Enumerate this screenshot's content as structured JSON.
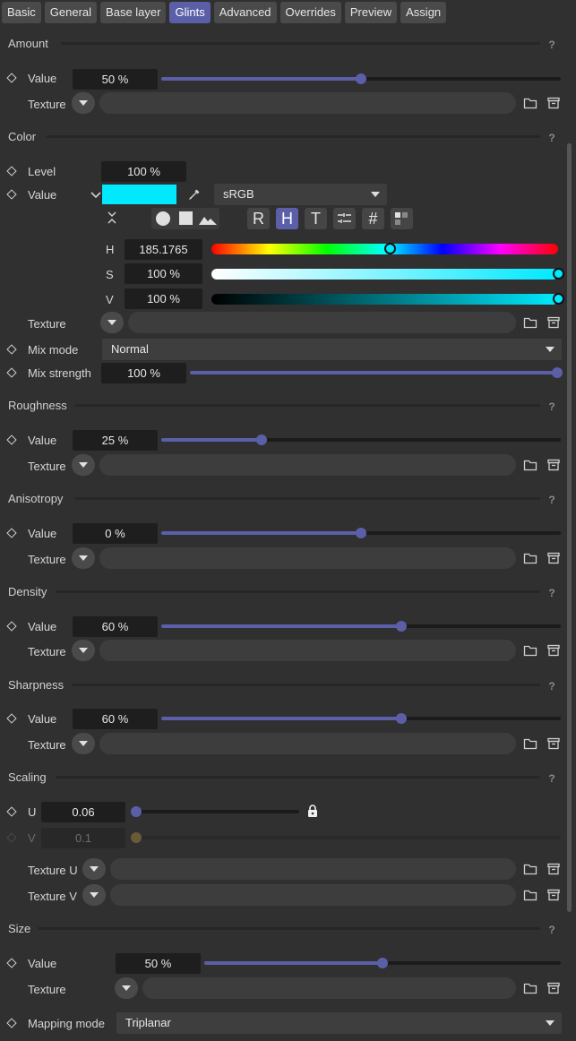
{
  "tabs": [
    "Basic",
    "General",
    "Base layer",
    "Glints",
    "Advanced",
    "Overrides",
    "Preview",
    "Assign"
  ],
  "active_tab": "Glints",
  "help_glyph": "?",
  "texture_label": "Texture",
  "value_label": "Value",
  "amount": {
    "title": "Amount",
    "value": "50 %",
    "fraction": 0.5
  },
  "color": {
    "title": "Color",
    "level_label": "Level",
    "level": "100 %",
    "value_label": "Value",
    "swatch": "#00e9ff",
    "colorspace": "sRGB",
    "mode_buttons": [
      "R",
      "H",
      "T",
      "#"
    ],
    "active_mode": "H",
    "h_label": "H",
    "h_value": "185.1765",
    "h_fraction": 0.514,
    "s_label": "S",
    "s_value": "100 %",
    "s_fraction": 1.0,
    "v_label": "V",
    "v_value": "100 %",
    "v_fraction": 1.0,
    "mix_mode_label": "Mix mode",
    "mix_mode": "Normal",
    "mix_strength_label": "Mix strength",
    "mix_strength": "100 %",
    "mix_strength_fraction": 1.0
  },
  "roughness": {
    "title": "Roughness",
    "value": "25 %",
    "fraction": 0.25
  },
  "anisotropy": {
    "title": "Anisotropy",
    "value": "0 %",
    "fraction": 0.5
  },
  "density": {
    "title": "Density",
    "value": "60 %",
    "fraction": 0.6
  },
  "sharpness": {
    "title": "Sharpness",
    "value": "60 %",
    "fraction": 0.6
  },
  "scaling": {
    "title": "Scaling",
    "u_label": "U",
    "u_value": "0.06",
    "v_label": "V",
    "v_value": "0.1",
    "texture_u_label": "Texture U",
    "texture_v_label": "Texture V"
  },
  "size": {
    "title": "Size",
    "value": "50 %",
    "fraction": 0.5
  },
  "mapping": {
    "label": "Mapping mode",
    "value": "Triplanar"
  },
  "colors": {
    "accent": "#5b5fa8",
    "background": "#303030",
    "field": "#1e1e1e"
  }
}
